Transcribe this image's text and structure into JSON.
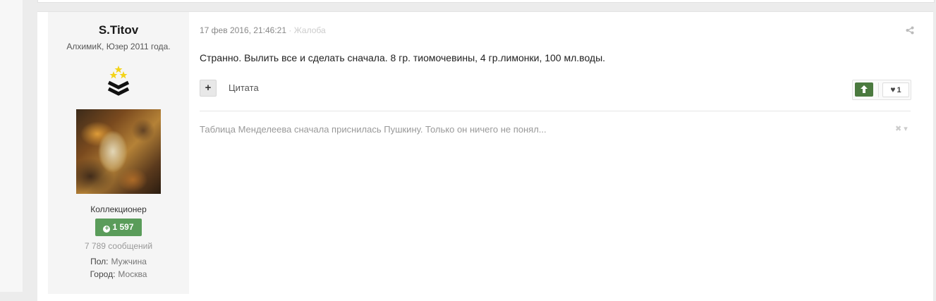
{
  "author": {
    "name": "S.Titov",
    "title": "АлхимиК, Юзер 2011 года.",
    "group": "Коллекционер",
    "reputation": "1 597",
    "post_count": "7 789 сообщений",
    "fields": [
      {
        "label": "Пол:",
        "value": "Мужчина"
      },
      {
        "label": "Город:",
        "value": "Москва"
      }
    ]
  },
  "post": {
    "date": "17 фев 2016, 21:46:21",
    "separator": "·",
    "report_label": "Жалоба",
    "content": "Странно. Вылить все и сделать сначала. 8 гр. тиомочевины, 4 гр.лимонки, 100 мл.воды.",
    "multiquote_label": "+",
    "quote_label": "Цитата",
    "reaction_count": "1",
    "signature": "Таблица Менделеева сначала приснилась Пушкину. Только он ничего не понял..."
  },
  "colors": {
    "reputation_bg": "#5a9c5a",
    "upvote_bg": "#4b7a3f",
    "rank_star": "#f3d317"
  },
  "icons": [
    "rank-icon",
    "share-icon",
    "upvote-icon",
    "heart-icon",
    "close-icon",
    "chevron-down-icon"
  ]
}
